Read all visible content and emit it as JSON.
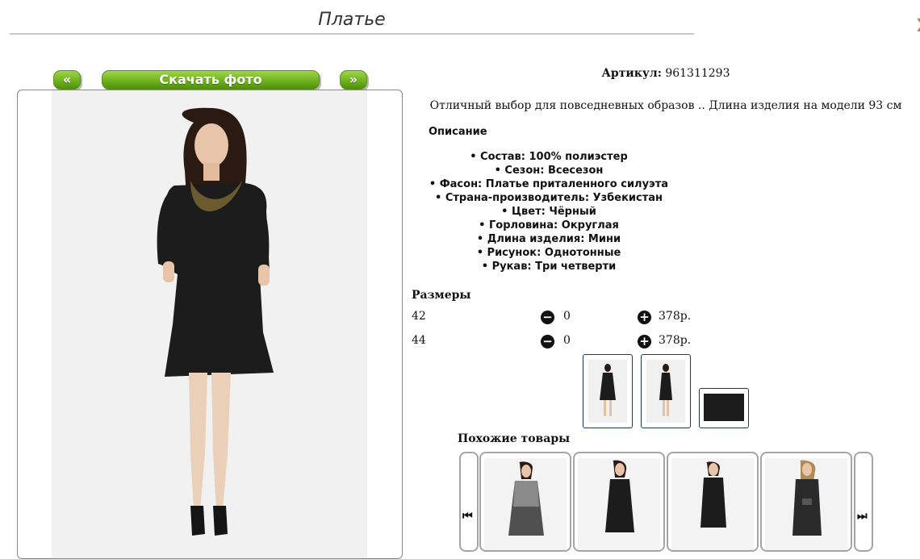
{
  "header": {
    "title": "Платье",
    "corner_mark": "❯"
  },
  "gallery": {
    "prev_label": "«",
    "download_label": "Скачать фото",
    "next_label": "»"
  },
  "product": {
    "article_label": "Артикул:",
    "article_value": "961311293",
    "short_description": "Отличный выбор для повседневных образов .. Длина изделия на модели 93 см",
    "description_heading": "Описание",
    "properties": [
      "Состав: 100% полиэстер",
      "Сезон: Всесезон",
      "Фасон: Платье приталенного силуэта",
      "Страна-производитель: Узбекистан",
      "Цвет: Чёрный",
      "Горловина: Округлая",
      "Длина изделия: Мини",
      "Рисунок: Однотонные",
      "Рукав: Три четверти"
    ]
  },
  "sizes": {
    "heading": "Размеры",
    "rows": [
      {
        "size": "42",
        "quantity": "0",
        "price": "378р."
      },
      {
        "size": "44",
        "quantity": "0",
        "price": "378р."
      }
    ]
  },
  "similar": {
    "heading": "Похожие товары"
  },
  "colors": {
    "dress_black": "#1c1c1c",
    "skin": "#e8c4a8",
    "hair_dark": "#2b1a12",
    "hair_light": "#b08a5a",
    "accent_green": "#6fb31f",
    "thumb_border": "#1d3c5a"
  }
}
